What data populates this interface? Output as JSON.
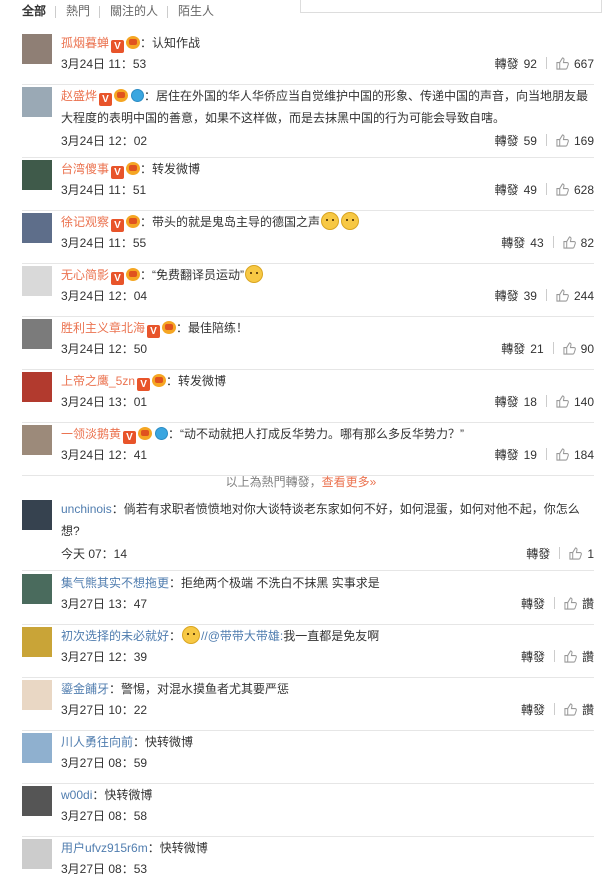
{
  "tabs": [
    "全部",
    "熱門",
    "關注的人",
    "陌生人"
  ],
  "hot_footer": {
    "prefix": "以上為熱門轉發，",
    "more": "查看更多»"
  },
  "repost_label": "轉發",
  "comments": [
    {
      "user": "孤烟暮蝉",
      "text": "认知作战",
      "date": "3月24日 11：53",
      "reposts": "92",
      "likes": "667",
      "icons": [
        "V",
        "crown"
      ]
    },
    {
      "user": "赵盛烨",
      "text": "居住在外国的华人华侨应当自觉维护中国的形象、传递中国的声音，向当地朋友最大程度的表明中国的善意，如果不这样做，而是去抹黑中国的行为可能会导致自嗐。",
      "date": "3月24日 12：02",
      "reposts": "59",
      "likes": "169",
      "icons": [
        "V",
        "crown",
        "globe"
      ]
    },
    {
      "user": "台湾傻事",
      "text": "转发微博",
      "date": "3月24日 11：51",
      "reposts": "49",
      "likes": "628",
      "icons": [
        "V",
        "crown"
      ]
    },
    {
      "user": "徐记观察",
      "text": "带头的就是鬼岛主导的德国之声",
      "date": "3月24日 11：55",
      "reposts": "43",
      "likes": "82",
      "icons": [
        "V",
        "crown"
      ],
      "emoji": 2
    },
    {
      "user": "无心简影",
      "text": "“免费翻译员运动”",
      "date": "3月24日 12：04",
      "reposts": "39",
      "likes": "244",
      "icons": [
        "V",
        "crown"
      ],
      "emoji": 1
    },
    {
      "user": "胜利主义章北海",
      "text": "最佳陪练！",
      "date": "3月24日 12：50",
      "reposts": "21",
      "likes": "90",
      "icons": [
        "V",
        "crown"
      ]
    },
    {
      "user": "上帝之鹰_5zn",
      "text": "转发微博",
      "date": "3月24日 13：01",
      "reposts": "18",
      "likes": "140",
      "icons": [
        "V",
        "crown"
      ]
    },
    {
      "user": "一领淡鹅黄",
      "text": "“动不动就把人打成反华势力。哪有那么多反华势力？”",
      "date": "3月24日 12：41",
      "reposts": "19",
      "likes": "184",
      "icons": [
        "V",
        "crown",
        "globe"
      ]
    },
    {
      "user": "unchinois",
      "text": "倘若有求职者愤愤地对你大谈特谈老东家如何不好，如何混蛋，如何对他不起，你怎么想?",
      "date": "今天 07：14",
      "reposts": "",
      "likes": "1",
      "icons": []
    },
    {
      "user": "集气熊其实不想拖更",
      "text": "拒绝两个极端 不洗白不抹黑 实事求是",
      "date": "3月27日 13：47",
      "reposts": "",
      "likes": "讚",
      "icons": []
    },
    {
      "user": "初次选择的未必就好",
      "text": "",
      "mention": "//@带带大带雄:",
      "text2": "我一直都是免友啊",
      "date": "3月27日 12：39",
      "reposts": "",
      "likes": "讚",
      "icons": [],
      "emoji": 1
    },
    {
      "user": "鎏金餔牙",
      "text": "警惕，对混水摸鱼者尤其要严惩",
      "date": "3月27日 10：22",
      "reposts": "",
      "likes": "讚",
      "icons": []
    },
    {
      "user": "川人勇往向前",
      "text": "快转微博",
      "date": "3月27日 08：59",
      "icons": []
    },
    {
      "user": "w00di",
      "text": "快转微博",
      "date": "3月27日 08：58",
      "icons": []
    },
    {
      "user": "用户ufvz915r6m",
      "text": "快转微博",
      "date": "3月27日 08：53",
      "icons": []
    }
  ]
}
